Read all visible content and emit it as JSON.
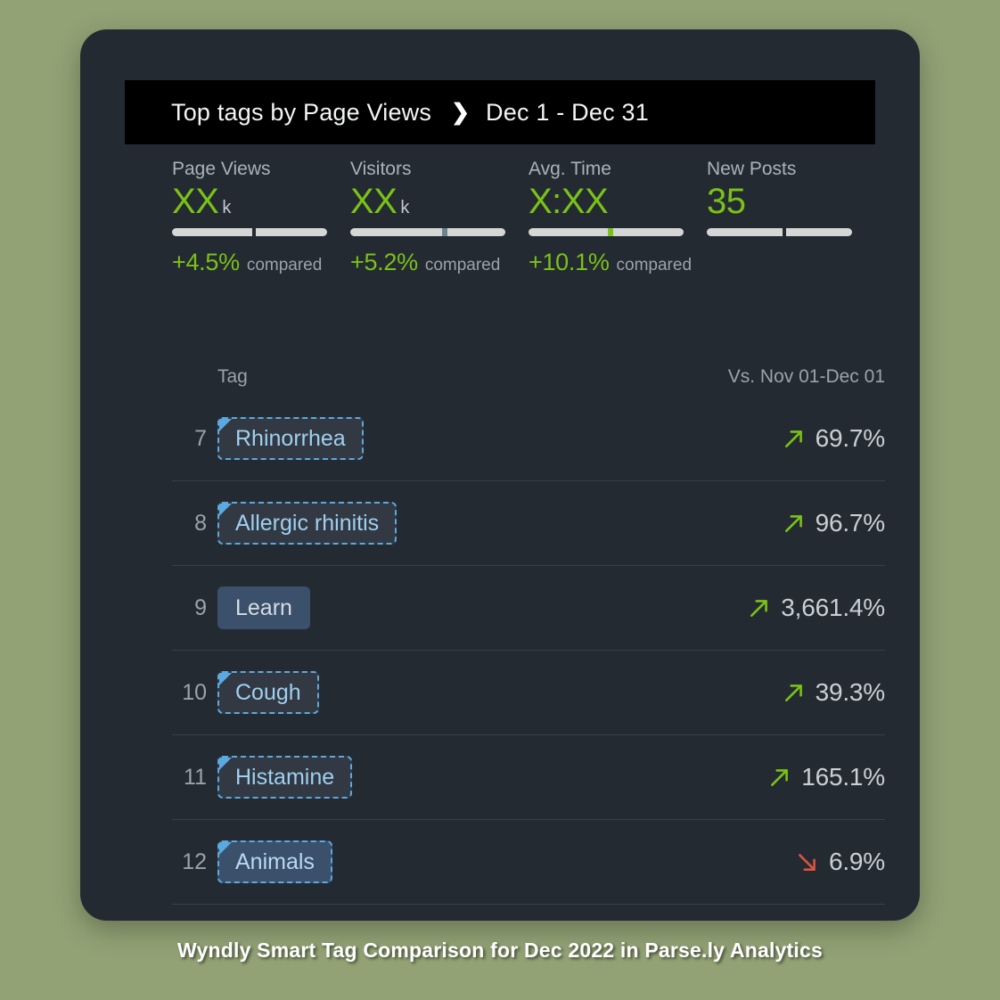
{
  "background_color": "#92a275",
  "card": {
    "background_color": "#242a31"
  },
  "header": {
    "title": "Top tags by Page Views",
    "separator_icon": "chevron-right-icon",
    "date_range": "Dec 1 - Dec 31"
  },
  "metrics": [
    {
      "label": "Page Views",
      "value": "XX",
      "unit": "k",
      "delta": "+4.5%",
      "compare_word": "compared",
      "bar": {
        "notch_position_pct": 52,
        "notch_color": "#242a31",
        "notch_style": "gap",
        "track_width_pct": 100
      }
    },
    {
      "label": "Visitors",
      "value": "XX",
      "unit": "k",
      "delta": "+5.2%",
      "compare_word": "compared",
      "bar": {
        "notch_position_pct": 59,
        "notch_color": "#6e8390",
        "notch_style": "steel",
        "track_width_pct": 100
      }
    },
    {
      "label": "Avg. Time",
      "value": "X:XX",
      "unit": "",
      "delta": "+10.1%",
      "compare_word": "compared",
      "bar": {
        "notch_position_pct": 51,
        "notch_color": "#7ac119",
        "notch_style": "green",
        "track_width_pct": 100
      }
    },
    {
      "label": "New Posts",
      "value": "35",
      "unit": "",
      "delta": "",
      "compare_word": "",
      "bar": {
        "notch_position_pct": 52,
        "notch_color": "#242a31",
        "notch_style": "gap",
        "track_width_pct": 100
      }
    }
  ],
  "table": {
    "columns": {
      "tag": "Tag",
      "vs": "Vs. Nov 01-Dec 01"
    },
    "rows": [
      {
        "rank": "7",
        "tag": "Rhinorrhea",
        "chip_style": "smart",
        "direction": "up",
        "delta": "69.7%"
      },
      {
        "rank": "8",
        "tag": "Allergic rhinitis",
        "chip_style": "smart",
        "direction": "up",
        "delta": "96.7%"
      },
      {
        "rank": "9",
        "tag": "Learn",
        "chip_style": "solid",
        "direction": "up",
        "delta": "3,661.4%"
      },
      {
        "rank": "10",
        "tag": "Cough",
        "chip_style": "smart",
        "direction": "up",
        "delta": "39.3%"
      },
      {
        "rank": "11",
        "tag": "Histamine",
        "chip_style": "smart",
        "direction": "up",
        "delta": "165.1%"
      },
      {
        "rank": "12",
        "tag": "Animals",
        "chip_style": "smart highlighted",
        "direction": "down",
        "delta": "6.9%"
      }
    ]
  },
  "caption": "Wyndly Smart Tag Comparison for Dec 2022 in Parse.ly Analytics",
  "colors": {
    "accent_green": "#7ac119",
    "accent_red": "#d9543f",
    "tag_blue": "#5aa9e0",
    "chip_highlight": "#3a506b"
  }
}
